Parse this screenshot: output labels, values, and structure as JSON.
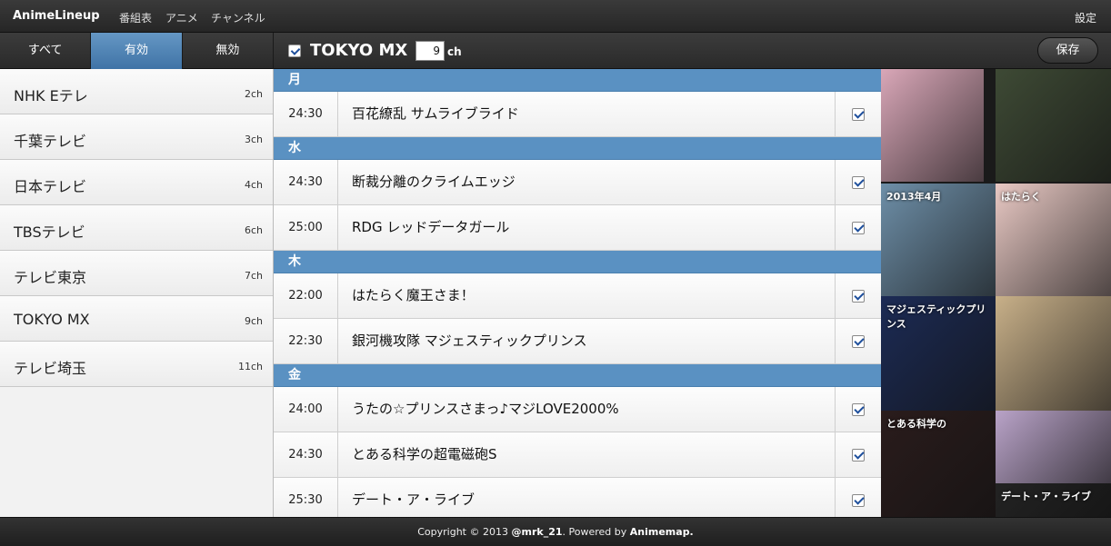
{
  "nav": {
    "brand": "AnimeLineup",
    "links": [
      "番組表",
      "アニメ",
      "チャンネル"
    ],
    "settings": "設定"
  },
  "filters": [
    "すべて",
    "有効",
    "無効"
  ],
  "active_filter": "有効",
  "channels": [
    {
      "name": "NHK Eテレ",
      "num": "2ch"
    },
    {
      "name": "千葉テレビ",
      "num": "3ch"
    },
    {
      "name": "日本テレビ",
      "num": "4ch"
    },
    {
      "name": "TBSテレビ",
      "num": "6ch"
    },
    {
      "name": "テレビ東京",
      "num": "7ch"
    },
    {
      "name": "TOKYO MX",
      "num": "9ch"
    },
    {
      "name": "テレビ埼玉",
      "num": "11ch"
    }
  ],
  "header": {
    "channel_title": "TOKYO MX",
    "channel_number": "9",
    "ch_unit": "ch",
    "save_label": "保存",
    "enabled": true
  },
  "schedule": [
    {
      "day": "月",
      "programs": [
        {
          "time": "24:30",
          "title": "百花繚乱 サムライブライド",
          "checked": true
        }
      ]
    },
    {
      "day": "水",
      "programs": [
        {
          "time": "24:30",
          "title": "断裁分離のクライムエッジ",
          "checked": true
        },
        {
          "time": "25:00",
          "title": "RDG レッドデータガール",
          "checked": true
        }
      ]
    },
    {
      "day": "木",
      "programs": [
        {
          "time": "22:00",
          "title": "はたらく魔王さま！",
          "checked": true
        },
        {
          "time": "22:30",
          "title": "銀河機攻隊 マジェスティックプリンス",
          "checked": true
        }
      ]
    },
    {
      "day": "金",
      "programs": [
        {
          "time": "24:00",
          "title": "うたの☆プリンスさまっ♪マジLOVE2000%",
          "checked": true
        },
        {
          "time": "24:30",
          "title": "とある科学の超電磁砲S",
          "checked": true
        },
        {
          "time": "25:30",
          "title": "デート・ア・ライブ",
          "checked": true
        }
      ]
    }
  ],
  "posters": [
    {
      "text": "",
      "color": "#d9a7b8"
    },
    {
      "text": "",
      "color": "#3e4a35"
    },
    {
      "text": "2013年4月",
      "color": "#6e8fa8"
    },
    {
      "text": "はたらく",
      "color": "#e9c9c4"
    },
    {
      "text": "マジェスティックプリンス",
      "color": "#1c2b55"
    },
    {
      "text": "",
      "color": "#c8b089"
    },
    {
      "text": "とある科学の",
      "color": "#2a1c1c"
    },
    {
      "text": "",
      "color": "#b9a3c8"
    },
    {
      "text": "デート・ア・ライブ",
      "color": "#232323"
    }
  ],
  "footer": {
    "copyright": "Copyright © 2013",
    "author": "@mrk_21",
    "powered": ". Powered by",
    "source": "Animemap."
  }
}
